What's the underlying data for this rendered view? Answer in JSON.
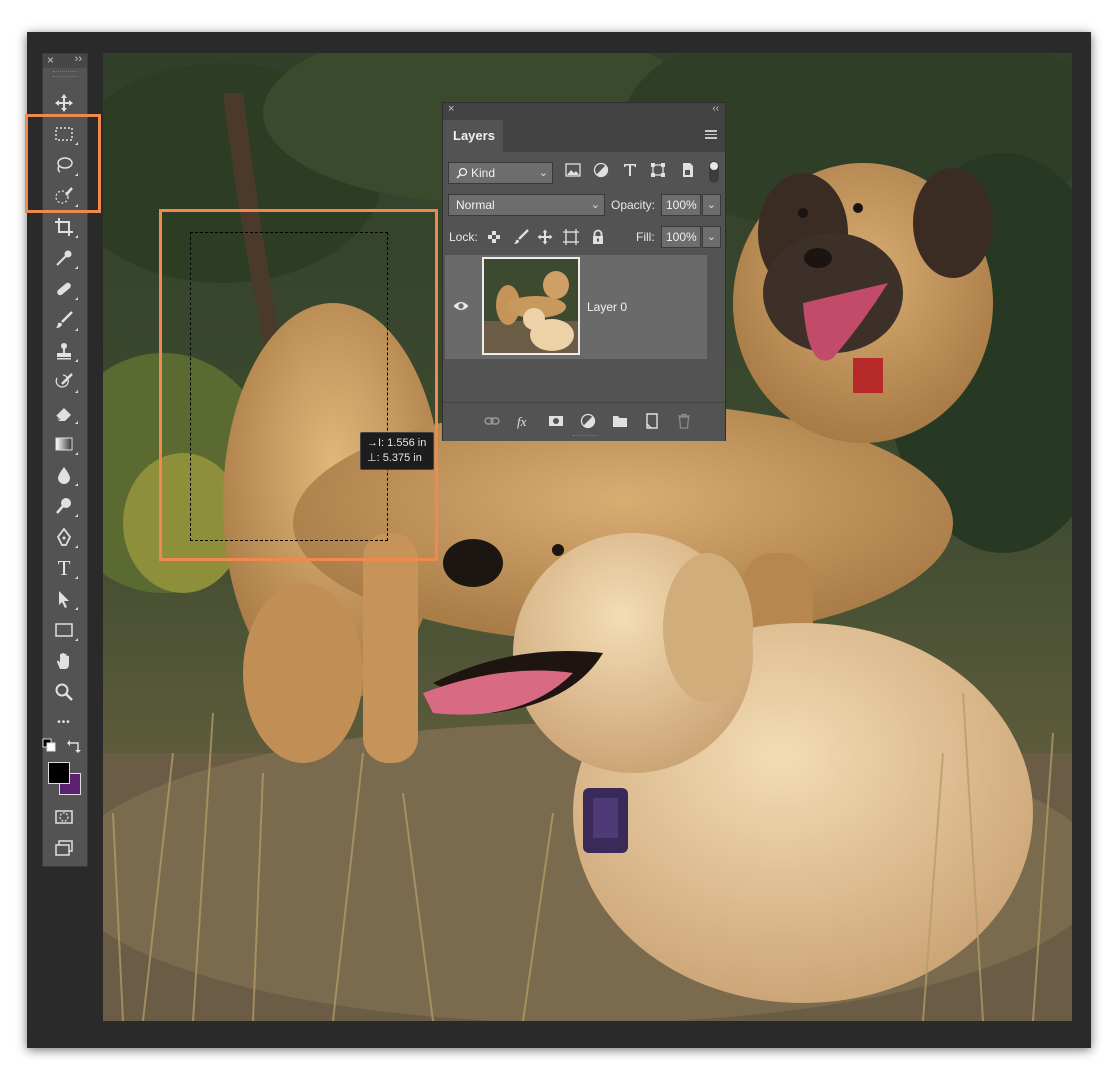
{
  "toolbar": {
    "close": "×",
    "collapse": "››",
    "tools": [
      "move",
      "rectangular-marquee",
      "lasso",
      "quick-selection",
      "crop",
      "eyedropper",
      "healing-brush",
      "brush",
      "clone-stamp",
      "history-brush",
      "eraser",
      "gradient",
      "blur",
      "dodge",
      "pen",
      "type",
      "path-selection",
      "rectangle",
      "hand",
      "zoom",
      "more-tools"
    ],
    "type_glyph": "T",
    "more_glyph": "•••",
    "foreground_color": "#000000",
    "background_color": "#5c2072"
  },
  "canvas": {
    "measure_width": "→I: 1.556 in",
    "measure_height": "⊥: 5.375 in",
    "highlight_color": "#f0894f"
  },
  "layers_panel": {
    "close": "×",
    "collapse": "‹‹",
    "tab": "Layers",
    "filter_kind": "Kind",
    "blend_mode": "Normal",
    "opacity_label": "Opacity:",
    "opacity_value": "100%",
    "lock_label": "Lock:",
    "fill_label": "Fill:",
    "fill_value": "100%",
    "layers": [
      {
        "name": "Layer 0",
        "visible": true
      }
    ]
  }
}
